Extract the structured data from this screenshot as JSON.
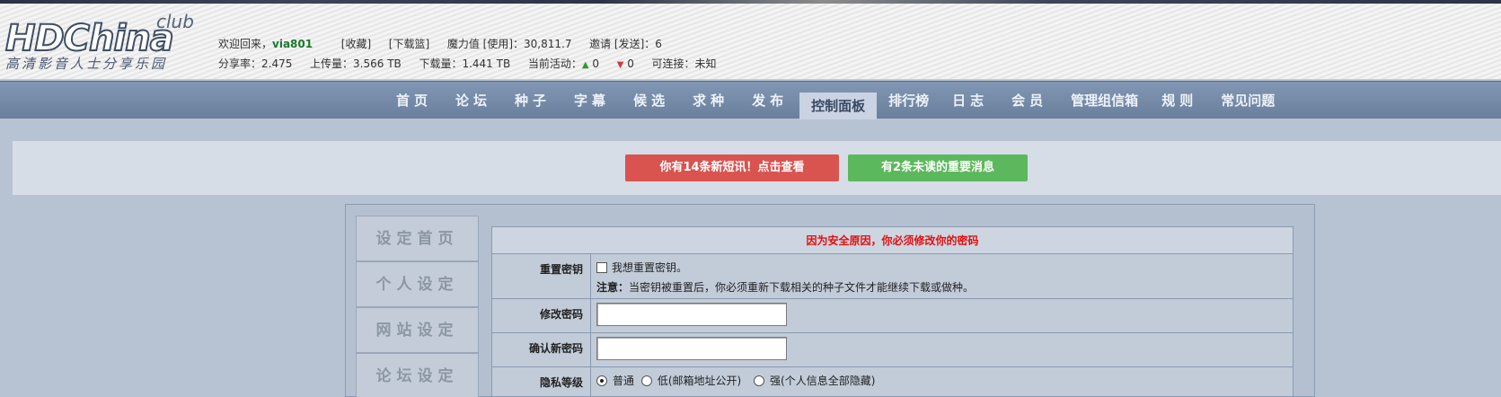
{
  "logo": {
    "main": "HDChina",
    "club": "club",
    "sub": "高清影音人士分享乐园"
  },
  "user": {
    "welcome": "欢迎回来，",
    "name": "via801",
    "favorites": "[收藏]",
    "downloading": "[下载篮]",
    "magic_label": "魔力值 [使用]：",
    "magic_value": "30,811.7",
    "invite_label": "邀请 [发送]：",
    "invite_value": "6",
    "share_ratio_label": "分享率：",
    "share_ratio": "2.475",
    "upload_label": "上传量：",
    "upload": "3.566 TB",
    "download_label": "下载量：",
    "download": "1.441 TB",
    "active_label": "当前活动：",
    "seeding": "0",
    "leeching": "0",
    "connectable_label": "可连接：",
    "connectable": "未知"
  },
  "nav": {
    "items": [
      {
        "label": "首页"
      },
      {
        "label": "论坛"
      },
      {
        "label": "种子"
      },
      {
        "label": "字幕"
      },
      {
        "label": "候选"
      },
      {
        "label": "求种"
      },
      {
        "label": "发布"
      },
      {
        "label": "控制面板",
        "active": true
      },
      {
        "label": "排行榜"
      },
      {
        "label": "日志"
      },
      {
        "label": "会员"
      },
      {
        "label": "管理组信箱"
      },
      {
        "label": "规则"
      },
      {
        "label": "常见问题"
      }
    ]
  },
  "messages": {
    "new_pm": "你有14条新短讯！点击查看",
    "unread_important": "有2条未读的重要消息",
    "pm_color": "#d9534f",
    "important_color": "#5cb85c"
  },
  "sidemenu": {
    "items": [
      {
        "label": "设定首页"
      },
      {
        "label": "个人设定"
      },
      {
        "label": "网站设定"
      },
      {
        "label": "论坛设定"
      }
    ]
  },
  "form": {
    "title": "因为安全原因，你必须修改你的密码",
    "reset_passkey": {
      "label": "重置密钥",
      "checkbox_label": "我想重置密钥。",
      "note_prefix": "注意：",
      "note_text": "当密钥被重置后，你必须重新下载相关的种子文件才能继续下载或做种。"
    },
    "change_password": {
      "label": "修改密码",
      "value": ""
    },
    "confirm_password": {
      "label": "确认新密码",
      "value": ""
    },
    "privacy": {
      "label": "隐私等级",
      "options": [
        {
          "label": "普通",
          "checked": true
        },
        {
          "label": "低(邮箱地址公开)",
          "checked": false
        },
        {
          "label": "强(个人信息全部隐藏)",
          "checked": false
        }
      ]
    }
  }
}
